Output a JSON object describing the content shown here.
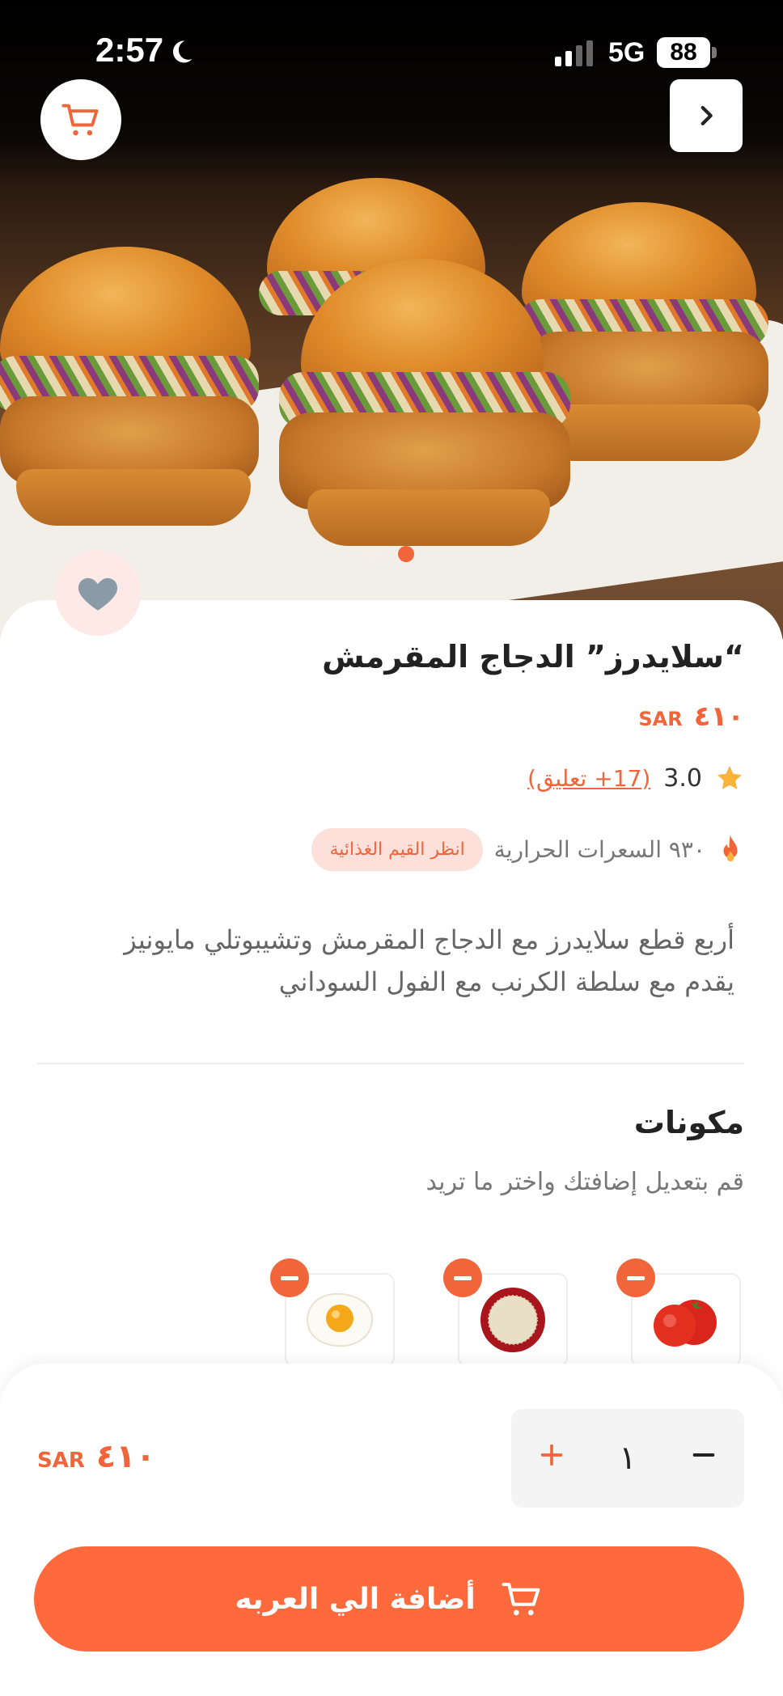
{
  "status_bar": {
    "time": "2:57",
    "network": "5G",
    "battery": "88"
  },
  "product": {
    "title": "“سلايدرز” الدجاج المقرمش",
    "price": "٤١٠",
    "currency": "SAR",
    "rating": "3.0",
    "reviews": "(17+ تعليق)",
    "calories": "٩٣٠ السعرات الحرارية",
    "nutrition_button": "انظر القيم الغذائية",
    "description_line1": "أربع قطع سلايدرز مع الدجاج المقرمش وتشيبوتلي مايونيز",
    "description_line2": "يقدم مع سلطة الكرنب مع الفول السوداني"
  },
  "ingredients": {
    "title": "مكونات",
    "subtitle": "قم بتعديل إضافتك واختر ما تريد",
    "items": [
      {
        "icon": "tomato-icon"
      },
      {
        "icon": "rice-plate-icon"
      },
      {
        "icon": "fried-egg-icon"
      }
    ]
  },
  "cart_bar": {
    "quantity": "١",
    "total": "٤١٠",
    "currency": "SAR",
    "add_button": "أضافة الي العربه"
  },
  "colors": {
    "accent": "#f0653a",
    "button": "#ff6a3d",
    "heart": "#8a9aa6"
  },
  "carousel": {
    "slides": 2,
    "active": 2
  }
}
